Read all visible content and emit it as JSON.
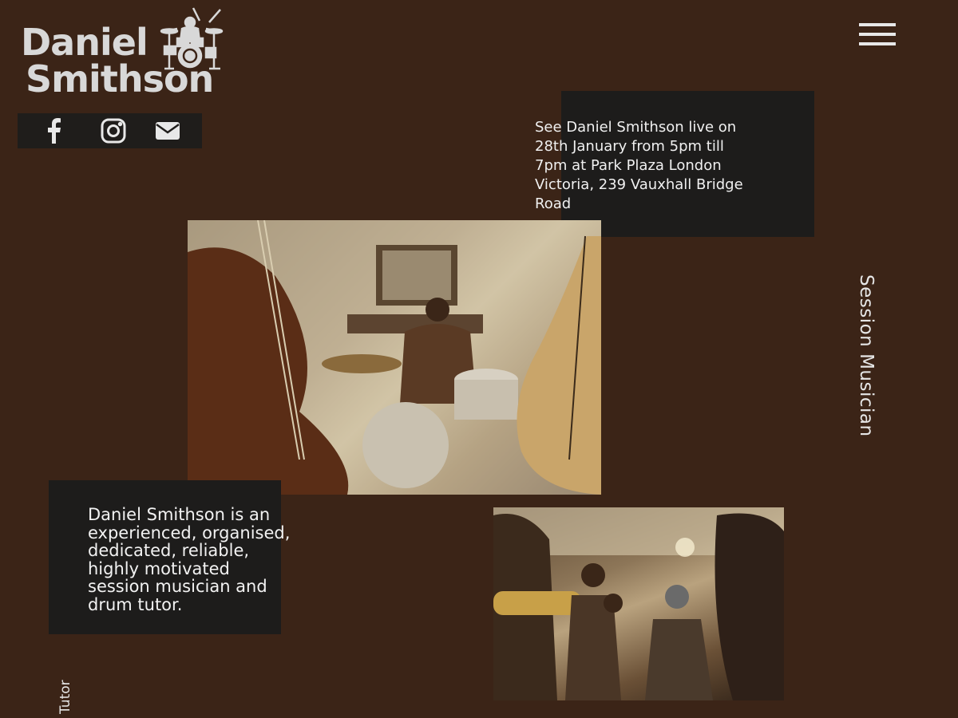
{
  "logo": {
    "line1": "Daniel",
    "line2": "Smithson"
  },
  "social": {
    "icons": [
      "facebook-icon",
      "instagram-icon",
      "mail-icon"
    ]
  },
  "menu": {
    "icon": "hamburger-menu-icon"
  },
  "event": {
    "text": "See Daniel Smithson live on 28th January from 5pm till 7pm at Park Plaza London Victoria, 239 Vauxhall Bridge Road"
  },
  "bio": {
    "text": "Daniel Smithson is an experienced, organised, dedicated, reliable, highly motivated session musician and drum tutor."
  },
  "side_labels": {
    "session": "Session Musician",
    "tutor": "Tutor"
  },
  "colors": {
    "background": "#3b2417",
    "panel": "#1d1c1b",
    "text": "#ececec"
  }
}
